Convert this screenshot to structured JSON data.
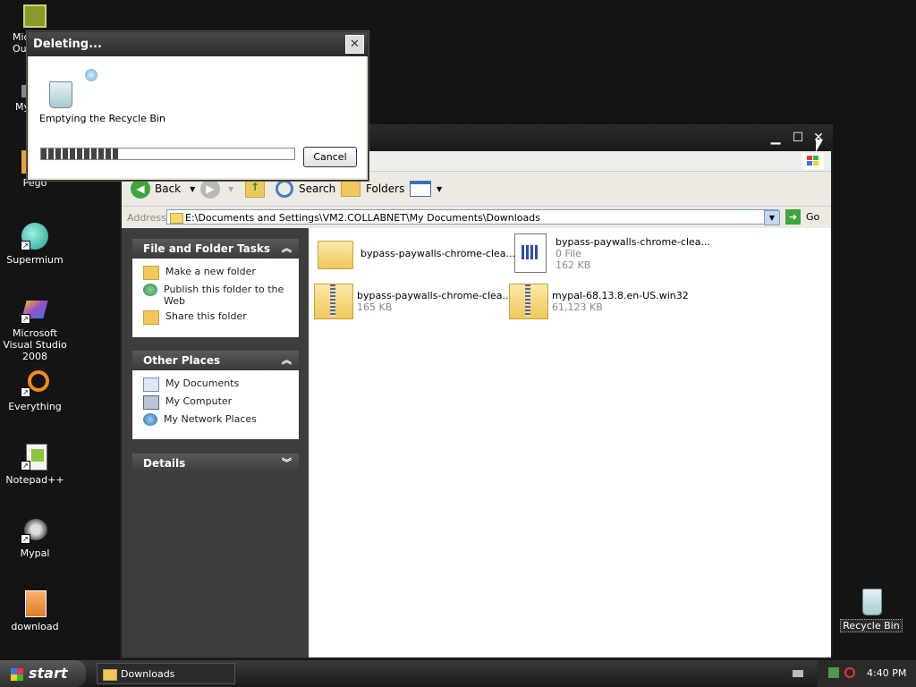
{
  "desktop_icons": [
    {
      "label": "Microsoft Outlook",
      "shown": "Mic Ou"
    },
    {
      "label": "My Computer",
      "shown": "My"
    },
    {
      "label": "Pego"
    },
    {
      "label": "Supermium"
    },
    {
      "label": "Microsoft Visual Studio 2008"
    },
    {
      "label": "Everything"
    },
    {
      "label": "Notepad++"
    },
    {
      "label": "Mypal"
    },
    {
      "label": "download"
    },
    {
      "label": "Recycle Bin"
    }
  ],
  "explorer": {
    "toolbar": {
      "back": "Back",
      "search": "Search",
      "folders": "Folders"
    },
    "address": {
      "label": "Address",
      "path": "E:\\Documents and Settings\\VM2.COLLABNET\\My Documents\\Downloads",
      "go": "Go"
    },
    "tasks": {
      "title": "File and Folder Tasks",
      "items": [
        "Make a new folder",
        "Publish this folder to the Web",
        "Share this folder"
      ]
    },
    "other_places": {
      "title": "Other Places",
      "items": [
        "My Documents",
        "My Computer",
        "My Network Places"
      ]
    },
    "details": {
      "title": "Details"
    },
    "files": [
      {
        "name": "bypass-paywalls-chrome-clea...",
        "meta": "",
        "type": "folder"
      },
      {
        "name": "bypass-paywalls-chrome-clea...",
        "meta1": "0 File",
        "meta2": "162 KB",
        "type": "file"
      },
      {
        "name": "bypass-paywalls-chrome-clea...",
        "meta": "165 KB",
        "type": "zip"
      },
      {
        "name": "mypal-68.13.8.en-US.win32",
        "meta": "61,123 KB",
        "type": "zip"
      }
    ]
  },
  "dialog": {
    "title": "Deleting...",
    "message": "Emptying the Recycle Bin",
    "progress": 0.31,
    "cancel": "Cancel"
  },
  "taskbar": {
    "start": "start",
    "item": "Downloads",
    "clock": "4:40 PM"
  }
}
